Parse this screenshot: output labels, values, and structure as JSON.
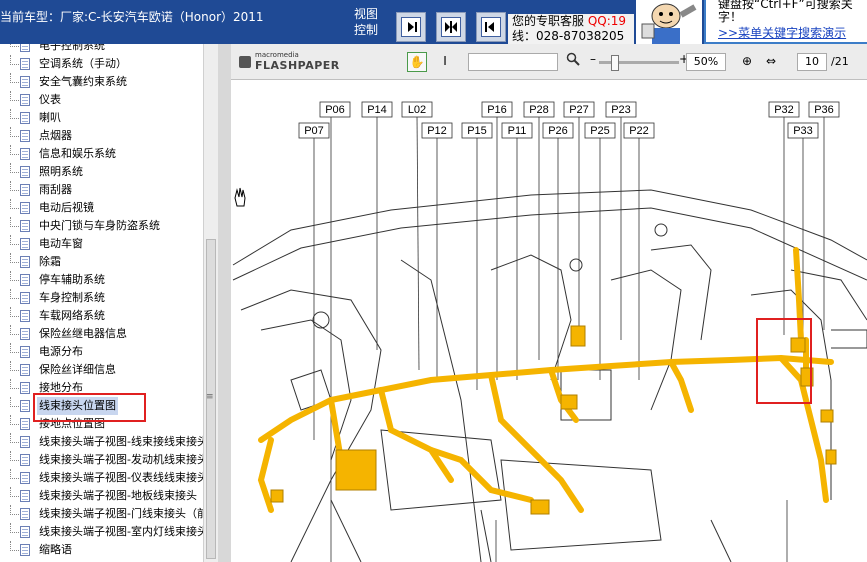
{
  "header": {
    "vehicle_title": "当前车型：厂家:C-长安汽车欧诺（Honor）2011",
    "view_control_label": "视图控制",
    "service_line1": "您的专职客服",
    "service_qq": "QQ:19",
    "service_line2": "线：028-87038205",
    "hint_line1": "键盘按“Ctrl+F”可搜索关",
    "hint_line2": "字！",
    "hint_link": ">>菜单关键字搜索演示"
  },
  "sidebar": {
    "items": [
      {
        "label": "电子控制系统"
      },
      {
        "label": "空调系统（手动）"
      },
      {
        "label": "安全气囊约束系统"
      },
      {
        "label": "仪表"
      },
      {
        "label": "喇叭"
      },
      {
        "label": "点烟器"
      },
      {
        "label": "信息和娱乐系统"
      },
      {
        "label": "照明系统"
      },
      {
        "label": "雨刮器"
      },
      {
        "label": "电动后视镜"
      },
      {
        "label": "中央门锁与车身防盗系统"
      },
      {
        "label": "电动车窗"
      },
      {
        "label": "除霜"
      },
      {
        "label": "停车辅助系统"
      },
      {
        "label": "车身控制系统"
      },
      {
        "label": "车载网络系统"
      },
      {
        "label": "保险丝继电器信息"
      },
      {
        "label": "电源分布"
      },
      {
        "label": "保险丝详细信息"
      },
      {
        "label": "接地分布"
      },
      {
        "label": "线束接头位置图",
        "selected": true
      },
      {
        "label": "接地点位置图"
      },
      {
        "label": "线束接头端子视图-线束接线束接头"
      },
      {
        "label": "线束接头端子视图-发动机线束接头"
      },
      {
        "label": "线束接头端子视图-仪表线线束接头"
      },
      {
        "label": "线束接头端子视图-地板线束接头"
      },
      {
        "label": "线束接头端子视图-门线束接头（前"
      },
      {
        "label": "线束接头端子视图-室内灯线束接头"
      },
      {
        "label": "缩略语"
      }
    ]
  },
  "viewer": {
    "logo_small": "macromedia",
    "logo_brand": "FLASHPAPER",
    "search_placeholder": "",
    "zoom": "50%",
    "page_current": "10",
    "page_total": "/21"
  },
  "diagram": {
    "callouts_top": [
      "P06",
      "P14",
      "L02",
      "P16",
      "P28",
      "P27",
      "P23",
      "P32",
      "P36"
    ],
    "callouts_second": [
      "P07",
      "P12",
      "P15",
      "P11",
      "P26",
      "P25",
      "P22",
      "P33"
    ]
  },
  "colors": {
    "header_bg": "#1f4a95",
    "harness": "#f5b400",
    "highlight_box": "#e02020",
    "selected_item_bg": "#c8d6ef"
  }
}
